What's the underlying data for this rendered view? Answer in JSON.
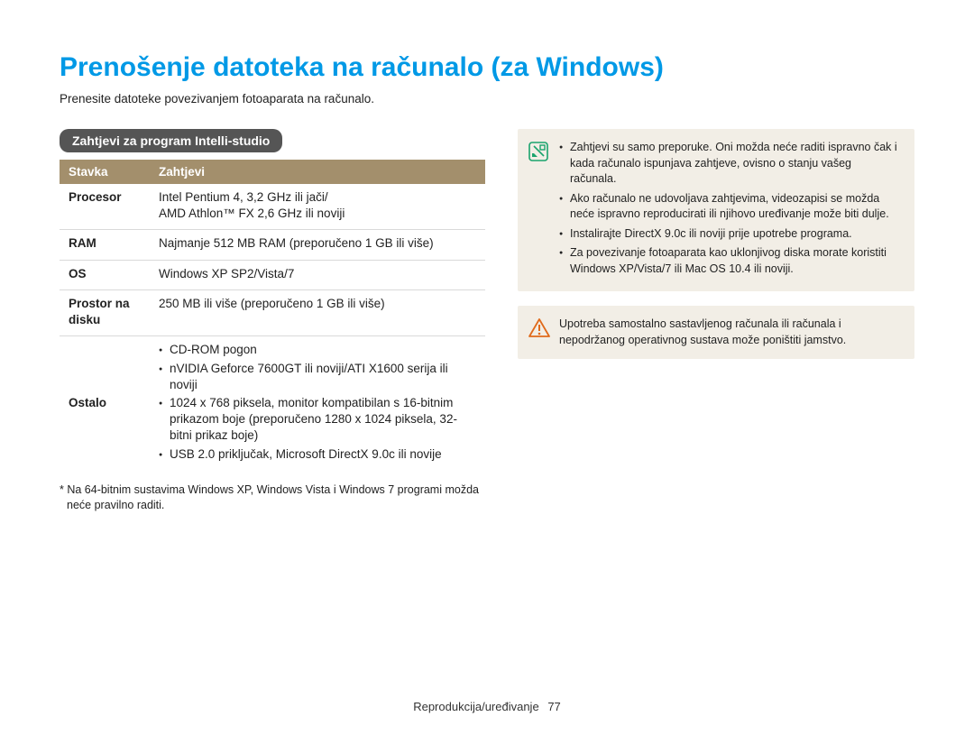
{
  "title": "Prenošenje datoteka na računalo (za Windows)",
  "intro": "Prenesite datoteke povezivanjem fotoaparata na računalo.",
  "section_heading": "Zahtjevi za program Intelli-studio",
  "table": {
    "headers": {
      "col1": "Stavka",
      "col2": "Zahtjevi"
    },
    "rows": {
      "procesor": {
        "label": "Procesor",
        "line1": "Intel Pentium 4, 3,2 GHz ili jači/",
        "line2": "AMD Athlon™ FX 2,6 GHz ili noviji"
      },
      "ram": {
        "label": "RAM",
        "value": "Najmanje 512 MB RAM (preporučeno 1 GB ili više)"
      },
      "os": {
        "label": "OS",
        "value": "Windows XP SP2/Vista/7"
      },
      "disk": {
        "label": "Prostor na disku",
        "value": "250 MB ili više (preporučeno 1 GB ili više)"
      },
      "ostalo": {
        "label": "Ostalo",
        "items": {
          "i0": "CD-ROM pogon",
          "i1": "nVIDIA Geforce 7600GT ili noviji/ATI X1600 serija ili noviji",
          "i2": "1024 x 768 piksela, monitor kompatibilan s 16-bitnim prikazom boje (preporučeno 1280 x 1024 piksela, 32-bitni prikaz boje)",
          "i3": "USB 2.0 priključak, Microsoft DirectX 9.0c ili novije"
        }
      }
    }
  },
  "footnote": "* Na 64-bitnim sustavima Windows XP, Windows Vista i Windows 7 programi možda neće pravilno raditi.",
  "info_note": {
    "items": {
      "i0": "Zahtjevi su samo preporuke. Oni možda neće raditi ispravno čak i kada računalo ispunjava zahtjeve, ovisno o stanju vašeg računala.",
      "i1": "Ako računalo ne udovoljava zahtjevima, videozapisi se možda neće ispravno reproducirati ili njihovo uređivanje može biti dulje.",
      "i2": "Instalirajte DirectX 9.0c ili noviji prije upotrebe programa.",
      "i3": "Za povezivanje fotoaparata kao uklonjivog diska morate koristiti Windows XP/Vista/7 ili Mac OS 10.4 ili noviji."
    }
  },
  "warning_note": "Upotreba samostalno sastavljenog računala ili računala i nepodržanog operativnog sustava može poništiti jamstvo.",
  "footer": {
    "section": "Reprodukcija/uređivanje",
    "page": "77"
  }
}
